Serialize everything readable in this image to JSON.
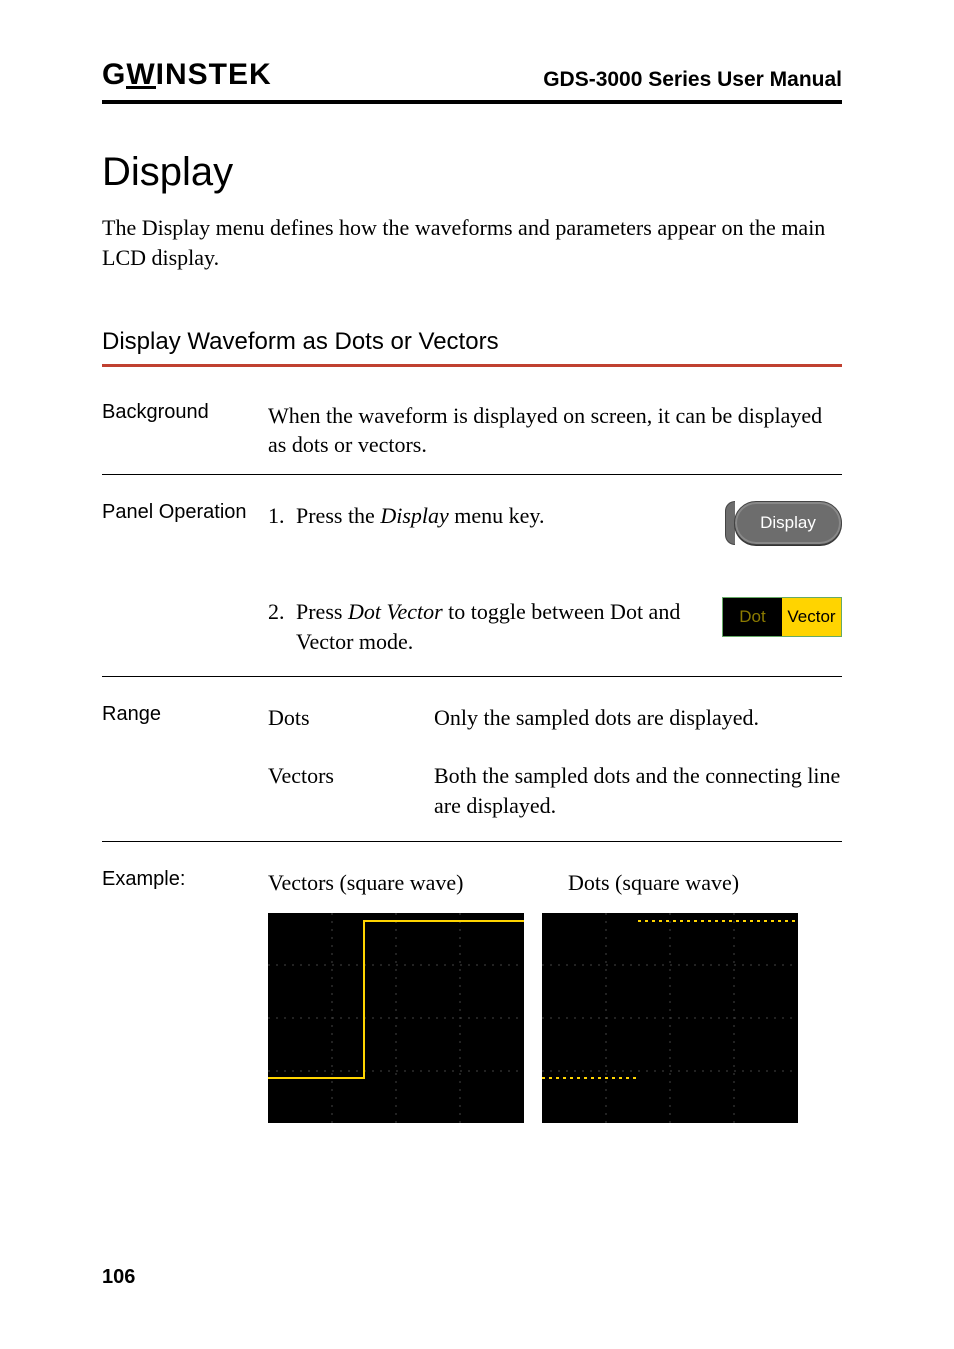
{
  "header": {
    "brand_left": "G",
    "brand_mid": "W",
    "brand_rest": "INSTEK",
    "doc_title": "GDS-3000 Series User Manual"
  },
  "section": {
    "title": "Display",
    "intro": "The Display menu defines how the waveforms and parameters appear on the main LCD display."
  },
  "subsection": {
    "title": "Display Waveform as Dots or Vectors"
  },
  "background": {
    "label": "Background",
    "text": "When the waveform is displayed on screen, it can be displayed as dots or vectors."
  },
  "panel_operation": {
    "label": "Panel Operation",
    "step1_num": "1.",
    "step1_a": "Press the ",
    "step1_kw": "Display",
    "step1_b": " menu key.",
    "display_btn": "Display",
    "step2_num": "2.",
    "step2_a": "Press ",
    "step2_kw": "Dot Vector",
    "step2_b": " to toggle between Dot and Vector mode.",
    "softkey_left": "Dot",
    "softkey_right": "Vector"
  },
  "range": {
    "label": "Range",
    "rows": [
      {
        "term": "Dots",
        "desc": "Only the sampled dots are displayed."
      },
      {
        "term": "Vectors",
        "desc": "Both the sampled dots and the connecting line are displayed."
      }
    ]
  },
  "example": {
    "label": "Example:",
    "left": "Vectors (square wave)",
    "right": "Dots (square wave)"
  },
  "page_number": "106"
}
